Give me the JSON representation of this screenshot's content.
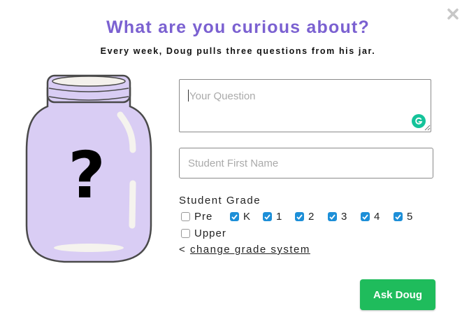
{
  "modal": {
    "title": "What are you curious about?",
    "subtitle": "Every week, Doug pulls three questions from his jar."
  },
  "jar": {
    "symbol": "?"
  },
  "form": {
    "question_placeholder": "Your Question",
    "name_placeholder": "Student First Name",
    "grade_label": "Student Grade",
    "grades": [
      {
        "label": "Pre",
        "checked": false
      },
      {
        "label": "K",
        "checked": true
      },
      {
        "label": "1",
        "checked": true
      },
      {
        "label": "2",
        "checked": true
      },
      {
        "label": "3",
        "checked": true
      },
      {
        "label": "4",
        "checked": true
      },
      {
        "label": "5",
        "checked": true
      },
      {
        "label": "Upper",
        "checked": false
      }
    ],
    "change_prefix": "<",
    "change_link": "change grade system",
    "submit_label": "Ask Doug"
  },
  "colors": {
    "title": "#7b61d1",
    "jar_fill": "#d9cdf4",
    "checkbox": "#1d8fd8",
    "button": "#1fbc5c",
    "grammarly": "#15c39a"
  }
}
